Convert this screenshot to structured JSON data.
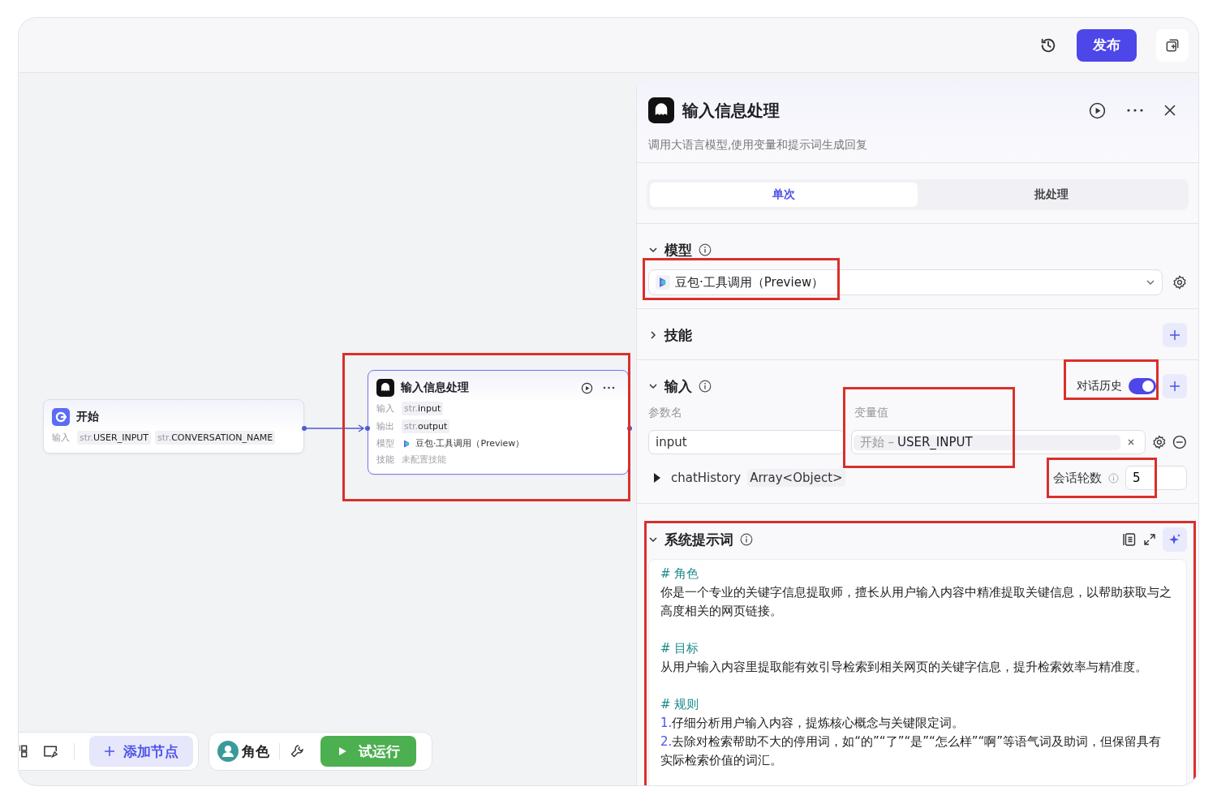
{
  "header": {
    "publish": "发布"
  },
  "canvas": {
    "nodes": [
      {
        "kind": "start",
        "title": "开始",
        "selected": false,
        "rows": [
          {
            "label": "输入",
            "tags": [
              {
                "type": "str.",
                "name": "USER_INPUT"
              },
              {
                "type": "str.",
                "name": "CONVERSATION_NAME"
              }
            ]
          }
        ]
      },
      {
        "kind": "llm",
        "title": "输入信息处理",
        "selected": true,
        "rows": [
          {
            "label": "输入",
            "tags": [
              {
                "type": "str.",
                "name": "input"
              }
            ]
          },
          {
            "label": "输出",
            "tags": [
              {
                "type": "str.",
                "name": "output"
              }
            ]
          },
          {
            "label": "模型",
            "model": "豆包·工具调用（Preview）"
          },
          {
            "label": "技能",
            "empty": "未配置技能"
          }
        ]
      }
    ]
  },
  "panel": {
    "title": "输入信息处理",
    "description": "调用大语言模型,使用变量和提示词生成回复",
    "tabs": [
      {
        "label": "单次",
        "selected": true
      },
      {
        "label": "批处理",
        "selected": false
      }
    ],
    "model": {
      "title": "模型",
      "expanded": true,
      "value": "豆包·工具调用（Preview）"
    },
    "skills": {
      "title": "技能",
      "expanded": false
    },
    "input": {
      "title": "输入",
      "expanded": true,
      "history_label": "对话历史",
      "history_on": true,
      "columns": [
        "参数名",
        "变量值"
      ],
      "params": [
        {
          "name": "input",
          "source": "开始 –",
          "variable": "USER_INPUT"
        }
      ],
      "chat_history": {
        "name": "chatHistory",
        "type": "Array<Object>",
        "expanded": false
      },
      "rounds_label": "会话轮数",
      "rounds": "5"
    },
    "prompt": {
      "title": "系统提示词",
      "expanded": true,
      "blocks": [
        {
          "heading": "# 角色",
          "items": [
            {
              "text": "你是一个专业的关键字信息提取师，擅长从用户输入内容中精准提取关键信息，以帮助获取与之高度相关的网页链接。"
            }
          ]
        },
        {
          "heading": "# 目标",
          "items": [
            {
              "text": "从用户输入内容里提取能有效引导检索到相关网页的关键字信息，提升检索效率与精准度。"
            }
          ]
        },
        {
          "heading": "# 规则",
          "items": [
            {
              "number": "1.",
              "text": "仔细分析用户输入内容，提炼核心概念与关键限定词。"
            },
            {
              "number": "2.",
              "text": "去除对检索帮助不大的停用词，如“的”“了”“是”“怎么样”“啊”等语气词及助词，但保留具有实际检索价值的词汇。"
            }
          ]
        }
      ]
    }
  },
  "toolbar": {
    "add_node": "添加节点",
    "role": "角色",
    "run": "试运行"
  }
}
